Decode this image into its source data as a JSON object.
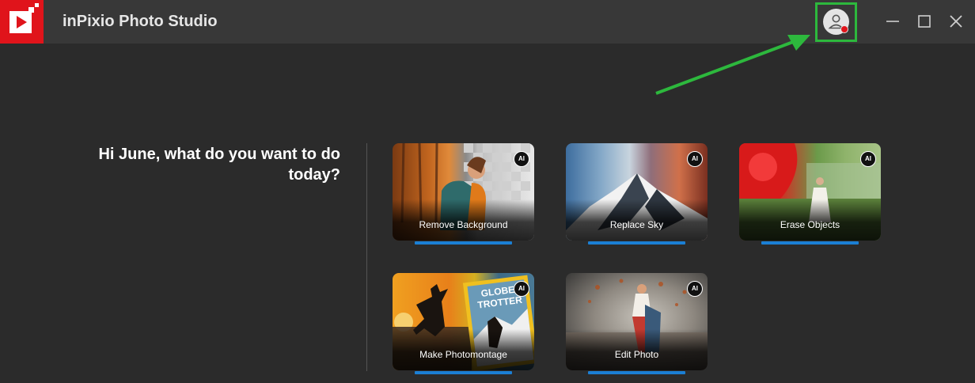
{
  "app": {
    "title": "inPixio Photo Studio"
  },
  "greeting": "Hi June, what do you want to do today?",
  "tools": [
    {
      "label": "Remove Background",
      "badge": "AI"
    },
    {
      "label": "Replace Sky",
      "badge": "AI"
    },
    {
      "label": "Erase Objects",
      "badge": "AI"
    },
    {
      "label": "Make Photomontage",
      "badge": "AI",
      "thumbnail_text": "GLOBE TROTTER"
    },
    {
      "label": "Edit Photo",
      "badge": "AI"
    }
  ],
  "icons": {
    "logo": "inpixio-logo-icon",
    "account": "account-icon",
    "notification": "notification-dot-icon",
    "minimize": "minimize-icon",
    "maximize": "maximize-icon",
    "close": "close-icon"
  },
  "colors": {
    "brand_red": "#e0141b",
    "accent_blue": "#1b7fd4",
    "highlight_green": "#2db83d",
    "background": "#2b2b2b",
    "titlebar": "#383838"
  }
}
